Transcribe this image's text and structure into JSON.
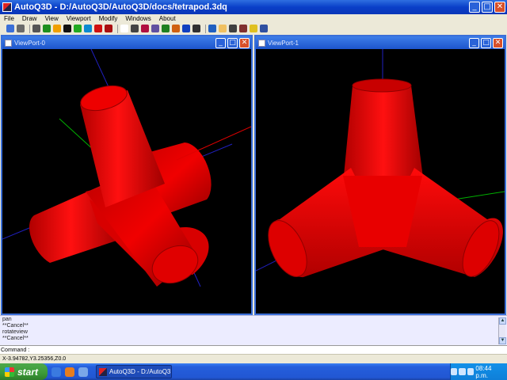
{
  "window": {
    "title": "AutoQ3D - D:/AutoQ3D/AutoQ3D/docs/tetrapod.3dq",
    "minimize": "_",
    "maximize": "□",
    "close": "✕"
  },
  "menu": [
    "File",
    "Draw",
    "View",
    "Viewport",
    "Modify",
    "Windows",
    "About"
  ],
  "toolbar": {
    "icons": [
      "open-icon",
      "save-icon",
      "select-icon",
      "line-icon",
      "curve-icon",
      "circle-icon",
      "sphere-icon",
      "torus-icon",
      "cone-icon",
      "cube-icon",
      "blank-icon",
      "cut-icon",
      "erase-icon",
      "paste-icon",
      "move-icon",
      "rotate-icon",
      "render-icon",
      "explode-icon",
      "zoom-icon",
      "pan-icon",
      "orbit-icon",
      "measure-icon",
      "snap-icon",
      "grid-icon"
    ],
    "colors": [
      "#3a6fd8",
      "#6a6a6a",
      "#555555",
      "#1e8f1e",
      "#f0a000",
      "#111111",
      "#22aa22",
      "#0a8ad0",
      "#d01010",
      "#aa1010",
      "#ffffff",
      "#444444",
      "#b01040",
      "#6050a0",
      "#208020",
      "#d06010",
      "#1040c0",
      "#303030",
      "#2060c0",
      "#f0c060",
      "#404040",
      "#803030",
      "#e0c020",
      "#3050a0"
    ]
  },
  "viewports": [
    {
      "title": "ViewPort-0",
      "minimize": "_",
      "maximize": "□",
      "close": "✕"
    },
    {
      "title": "ViewPort-1",
      "minimize": "_",
      "maximize": "□",
      "close": "✕"
    }
  ],
  "command_log": [
    "pan",
    "**Cancel**",
    "rotateview",
    "**Cancel**"
  ],
  "command": {
    "label": "Command :",
    "value": ""
  },
  "status": "X-3.94782,Y3.25356,Z0.0",
  "taskbar": {
    "start": "start",
    "task": "AutoQ3D - D:/AutoQ3...",
    "clock": "08:44 p.m."
  },
  "colors": {
    "object": "#e80000",
    "background": "#000000",
    "axis_x": "#e00000",
    "axis_y": "#00b000",
    "axis_z": "#2020c0"
  }
}
